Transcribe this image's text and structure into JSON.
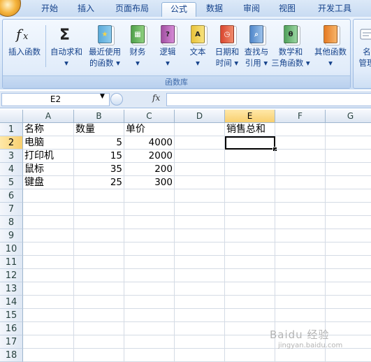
{
  "tabs": [
    "开始",
    "插入",
    "页面布局",
    "公式",
    "数据",
    "审阅",
    "视图",
    "开发工具"
  ],
  "active_tab": "公式",
  "ribbon": {
    "group_label": "函数库",
    "buttons": [
      {
        "label": "插入函数",
        "icon": "fx-icon"
      },
      {
        "label": "自动求和",
        "icon": "sigma-icon",
        "dropdown": "▾"
      },
      {
        "label": "最近使用的函数",
        "line1": "最近使用",
        "line2": "的函数 ▾",
        "icon": "book-star-icon"
      },
      {
        "label": "财务",
        "icon": "book-finance-icon",
        "dropdown": "▾"
      },
      {
        "label": "逻辑",
        "icon": "book-question-icon",
        "dropdown": "▾"
      },
      {
        "label": "文本",
        "icon": "book-text-icon",
        "dropdown": "▾"
      },
      {
        "label": "日期和时间",
        "line1": "日期和",
        "line2": "时间 ▾",
        "icon": "book-clock-icon"
      },
      {
        "label": "查找与引用",
        "line1": "查找与",
        "line2": "引用 ▾",
        "icon": "book-search-icon"
      },
      {
        "label": "数学和三角函数",
        "line1": "数学和",
        "line2": "三角函数 ▾",
        "icon": "book-theta-icon"
      },
      {
        "label": "其他函数",
        "icon": "books-more-icon",
        "dropdown": "▾"
      }
    ],
    "next_group": {
      "line1": "名",
      "line2": "管理"
    }
  },
  "formula_bar": {
    "name_box": "E2",
    "fx": "fx",
    "formula": ""
  },
  "columns": [
    "A",
    "B",
    "C",
    "D",
    "E",
    "F",
    "G"
  ],
  "rows": [
    "1",
    "2",
    "3",
    "4",
    "5",
    "6",
    "7",
    "8",
    "9",
    "10",
    "11",
    "12",
    "13",
    "14",
    "15",
    "16",
    "17",
    "18"
  ],
  "cells": {
    "A1": "名称",
    "B1": "数量",
    "C1": "单价",
    "E1": "销售总和",
    "A2": "电脑",
    "B2": "5",
    "C2": "4000",
    "A3": "打印机",
    "B3": "15",
    "C3": "2000",
    "A4": "鼠标",
    "B4": "35",
    "C4": "200",
    "A5": "键盘",
    "B5": "25",
    "C5": "300"
  },
  "selected_cell": "E2",
  "watermark": {
    "text": "Baidu 经验",
    "sub": "jingyan.baidu.com"
  }
}
